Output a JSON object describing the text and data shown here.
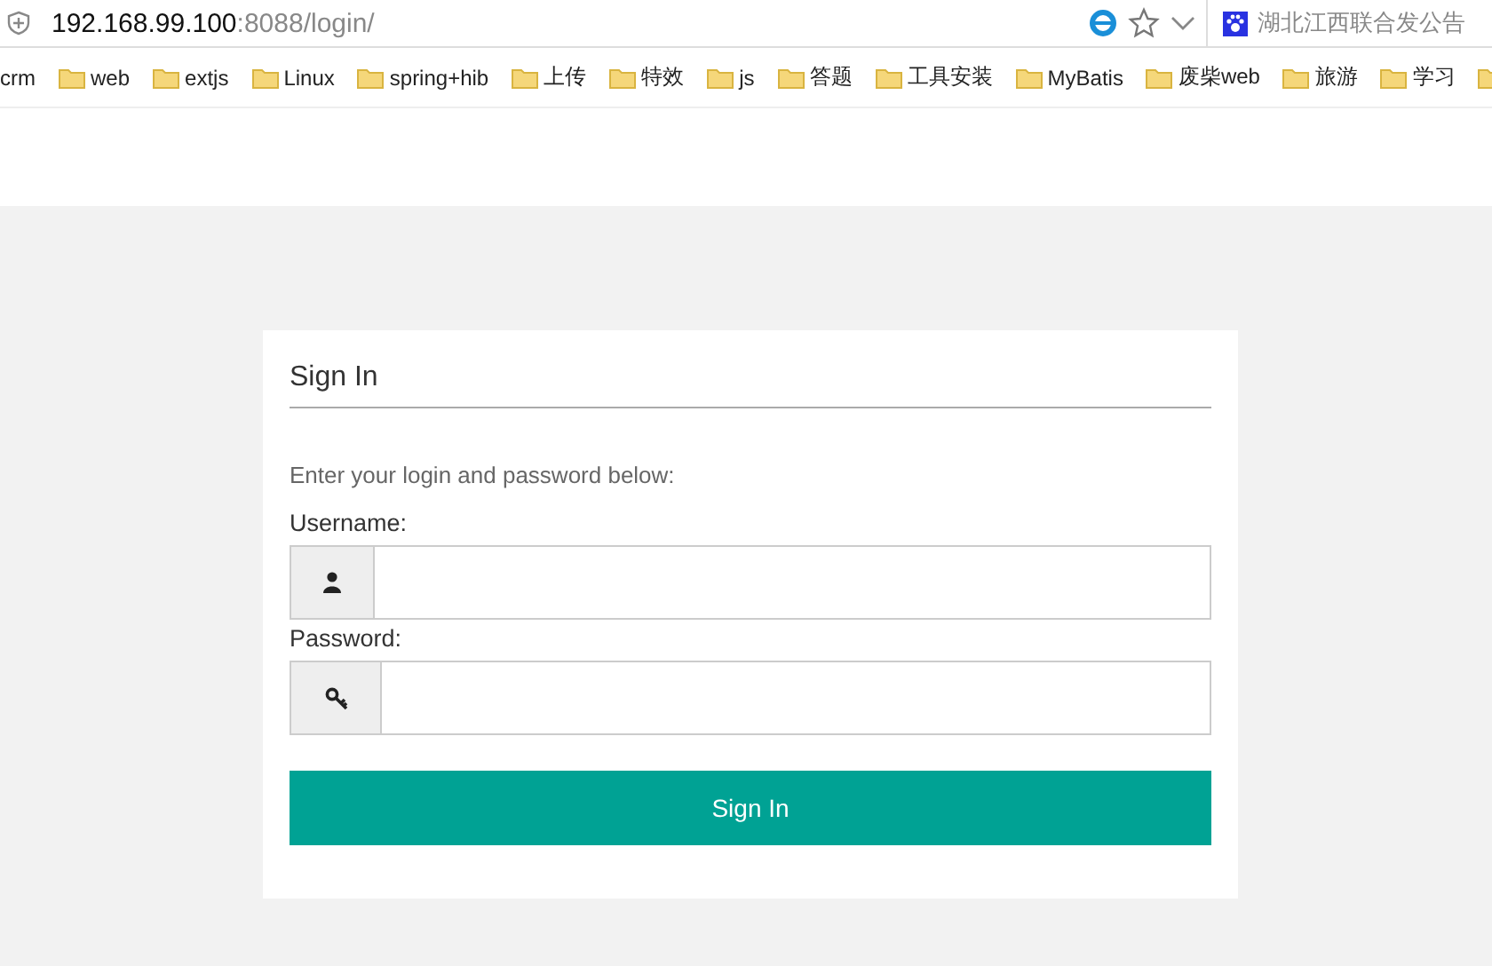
{
  "address_bar": {
    "host": "192.168.99.100",
    "path": ":8088/login/"
  },
  "search_box": {
    "text": "湖北江西联合发公告"
  },
  "bookmarks": [
    {
      "label": "crm",
      "folder": false
    },
    {
      "label": "web",
      "folder": true
    },
    {
      "label": "extjs",
      "folder": true
    },
    {
      "label": "Linux",
      "folder": true
    },
    {
      "label": "spring+hib",
      "folder": true
    },
    {
      "label": "上传",
      "folder": true
    },
    {
      "label": "特效",
      "folder": true
    },
    {
      "label": "js",
      "folder": true
    },
    {
      "label": "答题",
      "folder": true
    },
    {
      "label": "工具安装",
      "folder": true
    },
    {
      "label": "MyBatis",
      "folder": true
    },
    {
      "label": "废柴web",
      "folder": true
    },
    {
      "label": "旅游",
      "folder": true
    },
    {
      "label": "学习",
      "folder": true
    }
  ],
  "login": {
    "title": "Sign In",
    "intro": "Enter your login and password below:",
    "fields": [
      {
        "label": "Username:",
        "kind": "user"
      },
      {
        "label": "Password:",
        "kind": "key"
      }
    ],
    "button": "Sign In"
  }
}
